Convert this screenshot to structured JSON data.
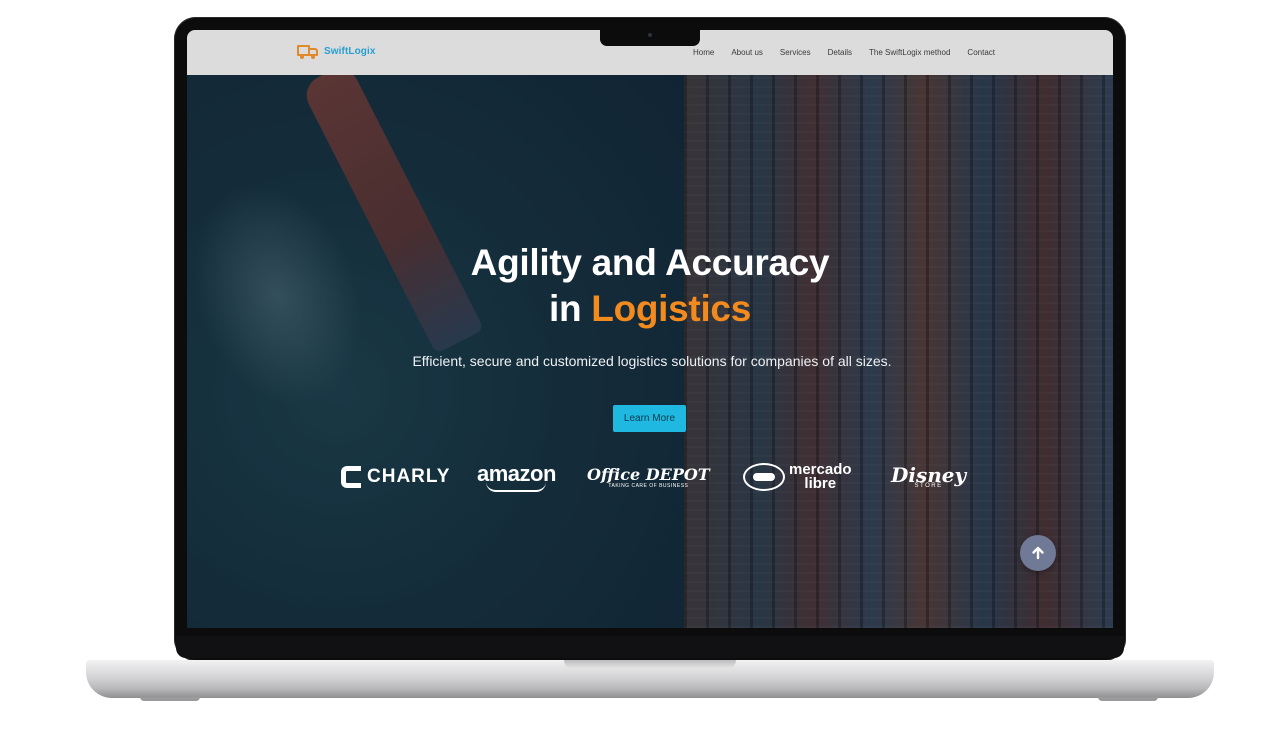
{
  "nav": {
    "brand": "SwiftLogix",
    "links": [
      "Home",
      "About us",
      "Services",
      "Details",
      "The SwiftLogix method",
      "Contact"
    ]
  },
  "hero": {
    "headline_line1": "Agility and Accuracy",
    "headline_in": "in",
    "headline_accent": "Logistics",
    "subtitle": "Efficient, secure and customized logistics solutions for companies of all sizes.",
    "cta_label": "Learn More",
    "accent_color": "#f28a1e",
    "cta_color": "#1fb8e0"
  },
  "partners": {
    "charly": "CHARLY",
    "amazon": "amazon",
    "office_depot": "Office DEPOT",
    "office_depot_tagline": "TAKING CARE OF BUSINESS",
    "mercado_libre_1": "mercado",
    "mercado_libre_2": "libre",
    "disney": "Disney",
    "disney_tagline": "STORE"
  },
  "icons": {
    "logo": "truck-icon",
    "scroll_top": "arrow-up-icon"
  }
}
